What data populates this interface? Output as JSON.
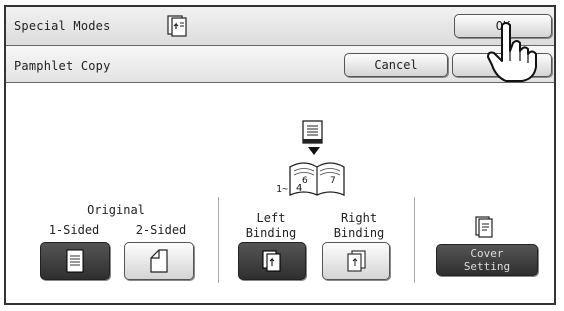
{
  "header": {
    "title": "Special Modes",
    "ok_label": "OK"
  },
  "subheader": {
    "title": "Pamphlet Copy",
    "cancel_label": "Cancel"
  },
  "original": {
    "label": "Original",
    "one_sided": "1-Sided",
    "two_sided": "2-Sided"
  },
  "binding": {
    "page_range_label": "1~",
    "left": "Left\nBinding",
    "right": "Right\nBinding"
  },
  "cover": {
    "label": "Cover\nSetting"
  },
  "icons": [
    "copy-mode-icon",
    "document-icon",
    "arrow-down-icon",
    "open-book-icon",
    "page-single-icon",
    "page-folded-icon",
    "left-binding-icon",
    "right-binding-icon",
    "cover-icon",
    "hand-pointer-icon"
  ]
}
